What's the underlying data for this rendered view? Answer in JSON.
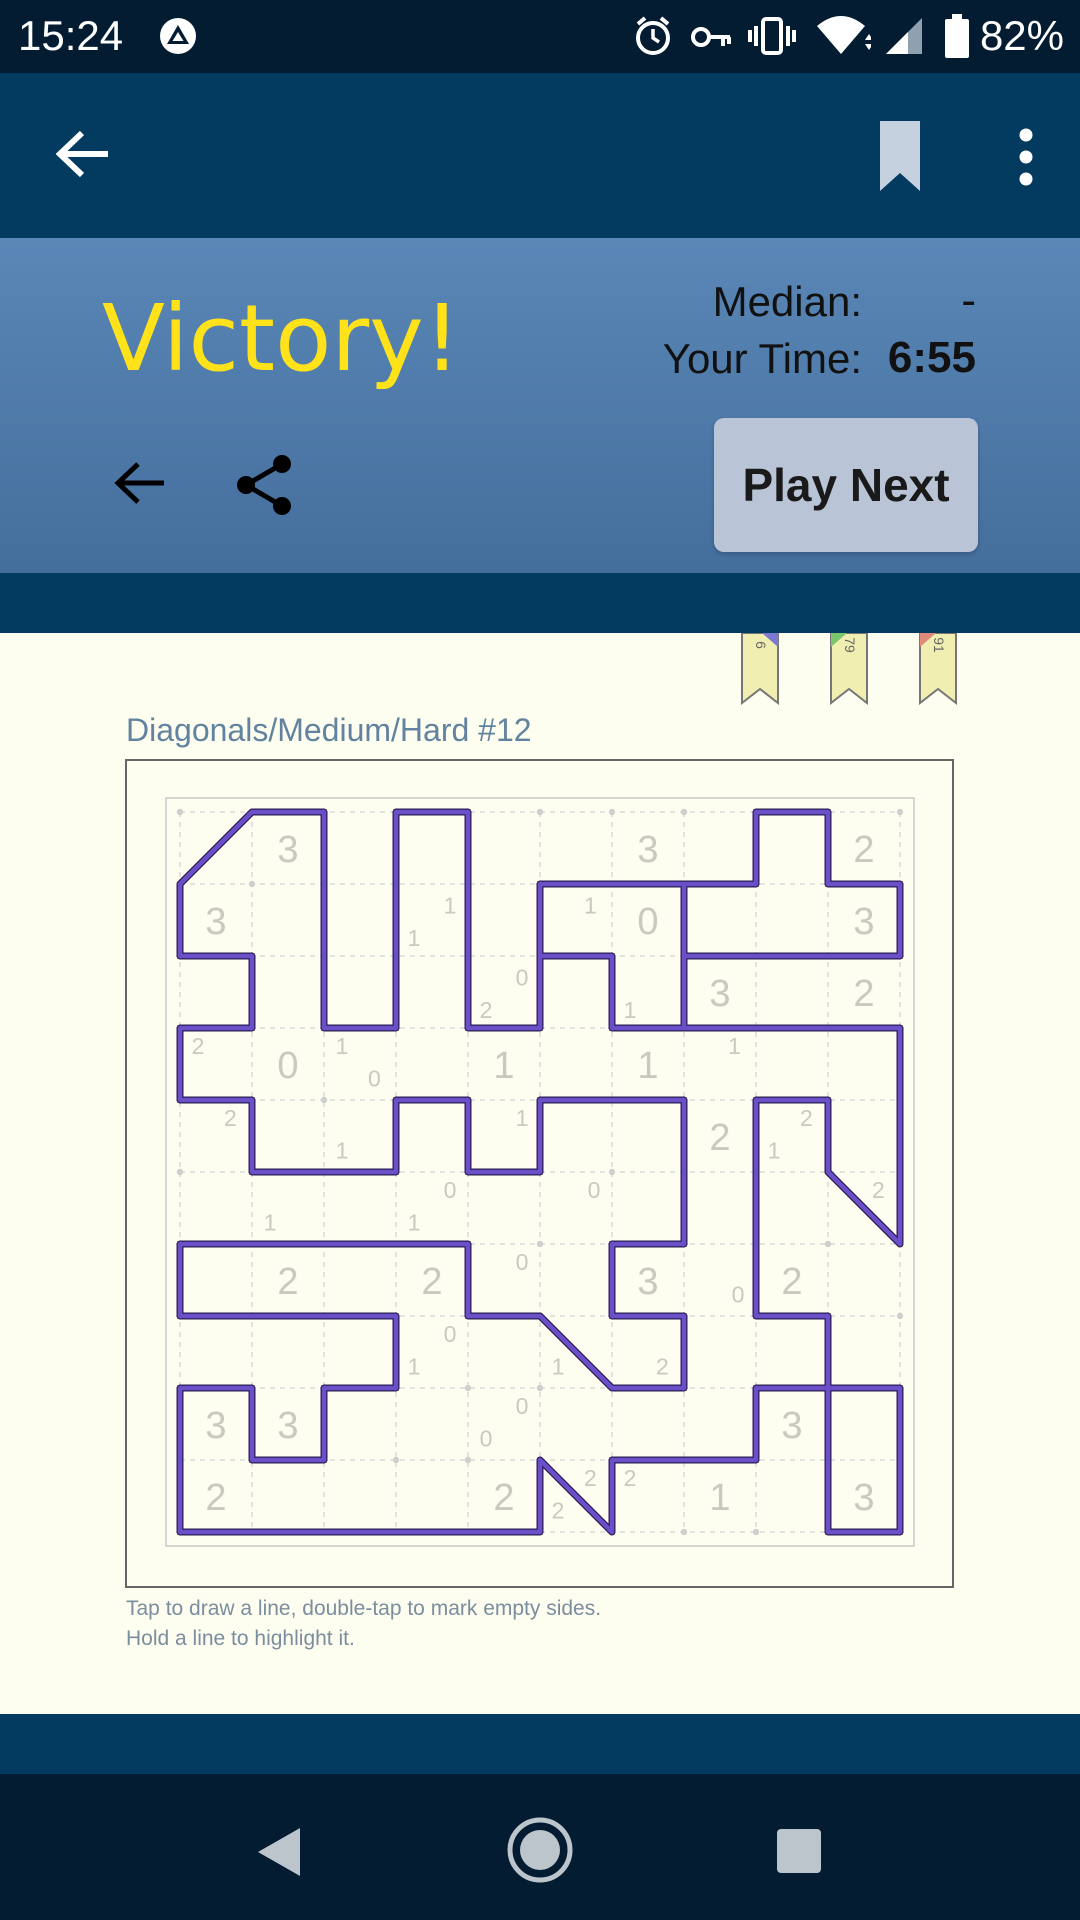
{
  "status_bar": {
    "time": "15:24",
    "battery": "82%"
  },
  "result": {
    "title": "Victory!",
    "median_label": "Median:",
    "median_value": "-",
    "time_label": "Your Time:",
    "time_value": "6:55",
    "play_next_label": "Play Next"
  },
  "ribbons": [
    "6",
    "79",
    "91"
  ],
  "puzzle": {
    "title": "Diagonals/Medium/Hard #12",
    "instructions_line1": "Tap to draw a line, double-tap to mark empty sides.",
    "instructions_line2": "Hold a line to highlight it.",
    "cell_clues": [
      {
        "r": 0,
        "c": 1,
        "v": "3"
      },
      {
        "r": 0,
        "c": 6,
        "v": "3"
      },
      {
        "r": 0,
        "c": 9,
        "v": "2"
      },
      {
        "r": 1,
        "c": 0,
        "v": "3"
      },
      {
        "r": 1,
        "c": 6,
        "v": "0"
      },
      {
        "r": 1,
        "c": 9,
        "v": "3"
      },
      {
        "r": 2,
        "c": 7,
        "v": "3"
      },
      {
        "r": 2,
        "c": 9,
        "v": "2"
      },
      {
        "r": 3,
        "c": 1,
        "v": "0"
      },
      {
        "r": 3,
        "c": 4,
        "v": "1"
      },
      {
        "r": 3,
        "c": 6,
        "v": "1"
      },
      {
        "r": 4,
        "c": 7,
        "v": "2"
      },
      {
        "r": 6,
        "c": 1,
        "v": "2"
      },
      {
        "r": 6,
        "c": 3,
        "v": "2"
      },
      {
        "r": 6,
        "c": 6,
        "v": "3"
      },
      {
        "r": 6,
        "c": 8,
        "v": "2"
      },
      {
        "r": 8,
        "c": 0,
        "v": "3"
      },
      {
        "r": 8,
        "c": 1,
        "v": "3"
      },
      {
        "r": 8,
        "c": 8,
        "v": "3"
      },
      {
        "r": 9,
        "c": 0,
        "v": "2"
      },
      {
        "r": 9,
        "c": 4,
        "v": "2"
      },
      {
        "r": 9,
        "c": 7,
        "v": "1"
      },
      {
        "r": 9,
        "c": 9,
        "v": "3"
      }
    ],
    "small_clues": [
      {
        "x": 3.75,
        "y": 1.3,
        "v": "1"
      },
      {
        "x": 3.25,
        "y": 1.75,
        "v": "1"
      },
      {
        "x": 5.7,
        "y": 1.3,
        "v": "1"
      },
      {
        "x": 4.75,
        "y": 2.3,
        "v": "0"
      },
      {
        "x": 4.25,
        "y": 2.75,
        "v": "2"
      },
      {
        "x": 6.25,
        "y": 2.75,
        "v": "1"
      },
      {
        "x": 0.25,
        "y": 3.25,
        "v": "2"
      },
      {
        "x": 2.25,
        "y": 3.25,
        "v": "1"
      },
      {
        "x": 2.7,
        "y": 3.7,
        "v": "0"
      },
      {
        "x": 7.7,
        "y": 3.25,
        "v": "1"
      },
      {
        "x": 0.7,
        "y": 4.25,
        "v": "2"
      },
      {
        "x": 2.25,
        "y": 4.7,
        "v": "1"
      },
      {
        "x": 4.75,
        "y": 4.25,
        "v": "1"
      },
      {
        "x": 8.7,
        "y": 4.25,
        "v": "2"
      },
      {
        "x": 8.25,
        "y": 4.7,
        "v": "1"
      },
      {
        "x": 3.75,
        "y": 5.25,
        "v": "0"
      },
      {
        "x": 5.75,
        "y": 5.25,
        "v": "0"
      },
      {
        "x": 9.7,
        "y": 5.25,
        "v": "2"
      },
      {
        "x": 1.25,
        "y": 5.7,
        "v": "1"
      },
      {
        "x": 3.25,
        "y": 5.7,
        "v": "1"
      },
      {
        "x": 4.75,
        "y": 6.25,
        "v": "0"
      },
      {
        "x": 7.75,
        "y": 6.7,
        "v": "0"
      },
      {
        "x": 3.75,
        "y": 7.25,
        "v": "0"
      },
      {
        "x": 3.25,
        "y": 7.7,
        "v": "1"
      },
      {
        "x": 5.25,
        "y": 7.7,
        "v": "1"
      },
      {
        "x": 6.7,
        "y": 7.7,
        "v": "2"
      },
      {
        "x": 4.75,
        "y": 8.25,
        "v": "0"
      },
      {
        "x": 4.25,
        "y": 8.7,
        "v": "0"
      },
      {
        "x": 5.7,
        "y": 9.25,
        "v": "2"
      },
      {
        "x": 6.25,
        "y": 9.25,
        "v": "2"
      },
      {
        "x": 5.25,
        "y": 9.7,
        "v": "2"
      }
    ],
    "line_color": "#6a4fc9",
    "loop": [
      [
        1,
        0
      ],
      [
        2,
        0
      ],
      [
        2,
        3
      ],
      [
        3,
        3
      ],
      [
        3,
        0
      ],
      [
        4,
        0
      ],
      [
        4,
        3
      ],
      [
        5,
        3
      ],
      [
        5,
        1
      ],
      [
        7,
        1
      ],
      [
        7,
        3
      ],
      [
        6,
        3
      ],
      [
        6,
        2
      ],
      [
        5,
        2
      ],
      [
        5,
        1
      ],
      [
        8,
        1
      ],
      [
        8,
        0
      ],
      [
        9,
        0
      ],
      [
        9,
        1
      ],
      [
        10,
        1
      ],
      [
        10,
        2
      ],
      [
        7,
        2
      ],
      [
        7,
        3
      ],
      [
        10,
        3
      ],
      [
        10,
        6
      ],
      [
        9,
        5
      ],
      [
        9,
        4
      ],
      [
        8,
        4
      ],
      [
        8,
        7
      ],
      [
        9,
        7
      ],
      [
        9,
        8
      ],
      [
        10,
        8
      ],
      [
        10,
        10
      ],
      [
        9,
        10
      ],
      [
        9,
        8
      ],
      [
        8,
        8
      ],
      [
        8,
        9
      ],
      [
        6,
        9
      ],
      [
        6,
        10
      ],
      [
        5,
        9
      ],
      [
        5,
        10
      ],
      [
        0,
        10
      ],
      [
        0,
        8
      ],
      [
        1,
        8
      ],
      [
        1,
        9
      ],
      [
        2,
        9
      ],
      [
        2,
        8
      ],
      [
        3,
        8
      ],
      [
        3,
        7
      ],
      [
        0,
        7
      ],
      [
        0,
        6
      ],
      [
        4,
        6
      ],
      [
        4,
        7
      ],
      [
        5,
        7
      ],
      [
        6,
        8
      ],
      [
        7,
        8
      ],
      [
        7,
        7
      ],
      [
        6,
        7
      ],
      [
        6,
        6
      ],
      [
        7,
        6
      ],
      [
        7,
        4
      ],
      [
        5,
        4
      ],
      [
        5,
        5
      ],
      [
        4,
        5
      ],
      [
        4,
        4
      ],
      [
        3,
        4
      ],
      [
        3,
        5
      ],
      [
        1,
        5
      ],
      [
        1,
        4
      ],
      [
        0,
        4
      ],
      [
        0,
        3
      ],
      [
        1,
        3
      ],
      [
        1,
        2
      ],
      [
        0,
        2
      ],
      [
        0,
        1
      ]
    ]
  }
}
